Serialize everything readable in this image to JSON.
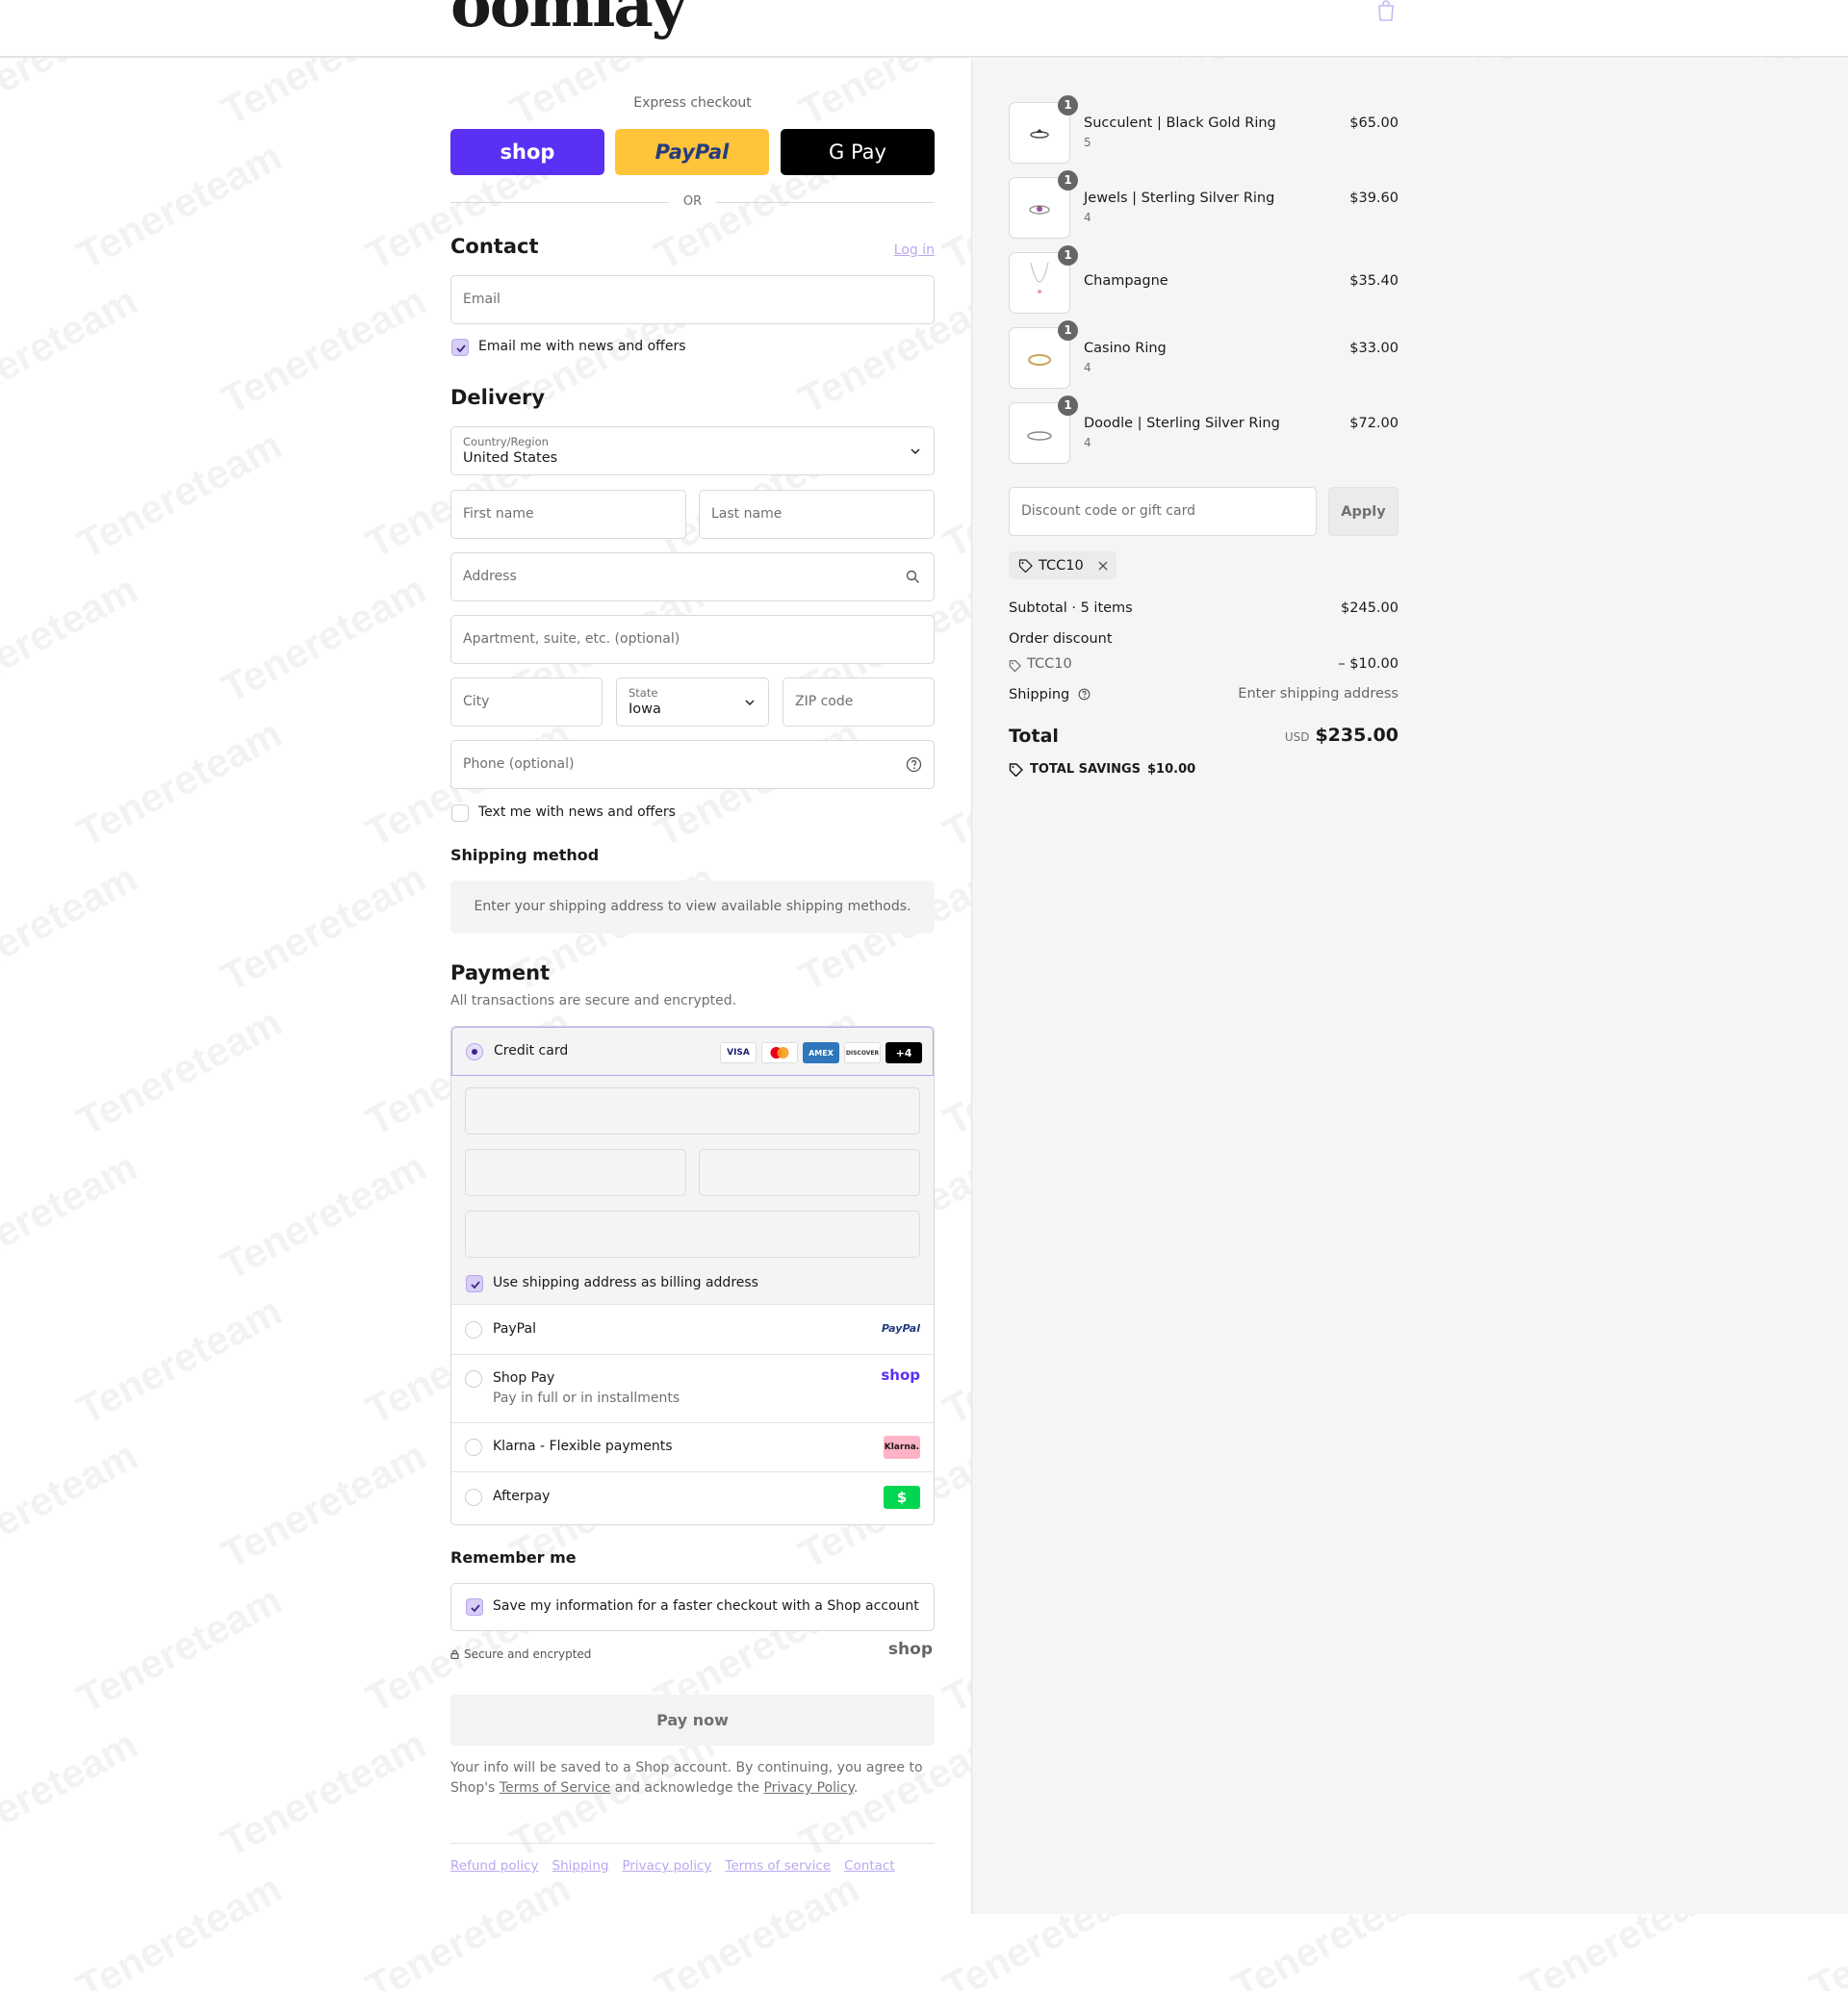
{
  "brand": {
    "logo_text": "oomlay",
    "watermark": "Tenereteam"
  },
  "express": {
    "title": "Express checkout",
    "buttons": [
      {
        "label": "shop",
        "color": "#5a31f4"
      },
      {
        "label": "PayPal",
        "color": "#ffc439"
      },
      {
        "label": "G Pay",
        "color": "#000000"
      }
    ],
    "or_label": "OR"
  },
  "contact": {
    "title": "Contact",
    "login_link": "Log in",
    "email_placeholder": "Email",
    "news_checkbox_label": "Email me with news and offers",
    "news_checked": true
  },
  "delivery": {
    "title": "Delivery",
    "country_label": "Country/Region",
    "country_value": "United States",
    "first_name_placeholder": "First name",
    "last_name_placeholder": "Last name",
    "address_placeholder": "Address",
    "apartment_placeholder": "Apartment, suite, etc. (optional)",
    "city_placeholder": "City",
    "state_label": "State",
    "state_value": "Iowa",
    "zip_placeholder": "ZIP code",
    "phone_placeholder": "Phone (optional)",
    "text_checkbox_label": "Text me with news and offers",
    "text_checked": false
  },
  "shipping_method": {
    "title": "Shipping method",
    "message": "Enter your shipping address to view available shipping methods."
  },
  "payment": {
    "title": "Payment",
    "subtitle": "All transactions are secure and encrypted.",
    "credit_card_label": "Credit card",
    "card_logos": [
      "VISA",
      "MC",
      "AMEX",
      "DISCOVER",
      "+4"
    ],
    "billing_checkbox_label": "Use shipping address as billing address",
    "billing_checked": true,
    "options": [
      {
        "label": "PayPal",
        "logo": "PayPal"
      },
      {
        "label": "Shop Pay",
        "sublabel": "Pay in full or in installments",
        "logo": "shop"
      },
      {
        "label": "Klarna - Flexible payments",
        "logo": "Klarna."
      },
      {
        "label": "Afterpay",
        "logo": "$"
      }
    ]
  },
  "remember": {
    "title": "Remember me",
    "checkbox_label": "Save my information for a faster checkout with a Shop account",
    "checked": true,
    "secure_label": "Secure and encrypted",
    "shop_logo": "shop"
  },
  "pay_now_label": "Pay now",
  "legal": {
    "prefix": "Your info will be saved to a Shop account. By continuing, you agree to Shop's",
    "terms": "Terms of Service",
    "middle": "and acknowledge the",
    "privacy": "Privacy Policy",
    "suffix": "."
  },
  "footer_links": [
    "Refund policy",
    "Shipping",
    "Privacy policy",
    "Terms of service",
    "Contact"
  ],
  "order": {
    "items": [
      {
        "name": "Succulent | Black Gold Ring",
        "variant": "5",
        "qty": "1",
        "price": "$65.00"
      },
      {
        "name": "Jewels | Sterling Silver Ring",
        "variant": "4",
        "qty": "1",
        "price": "$39.60"
      },
      {
        "name": "Champagne",
        "variant": "",
        "qty": "1",
        "price": "$35.40"
      },
      {
        "name": "Casino Ring",
        "variant": "4",
        "qty": "1",
        "price": "$33.00"
      },
      {
        "name": "Doodle | Sterling Silver Ring",
        "variant": "4",
        "qty": "1",
        "price": "$72.00"
      }
    ],
    "discount_placeholder": "Discount code or gift card",
    "apply_label": "Apply",
    "applied_code": "TCC10",
    "subtotal_label": "Subtotal · 5 items",
    "subtotal_value": "$245.00",
    "order_discount_label": "Order discount",
    "discount_code": "TCC10",
    "discount_value": "– $10.00",
    "shipping_label": "Shipping",
    "shipping_value": "Enter shipping address",
    "total_label": "Total",
    "currency": "USD",
    "total_value": "$235.00",
    "savings_label": "TOTAL SAVINGS",
    "savings_value": "$10.00"
  }
}
